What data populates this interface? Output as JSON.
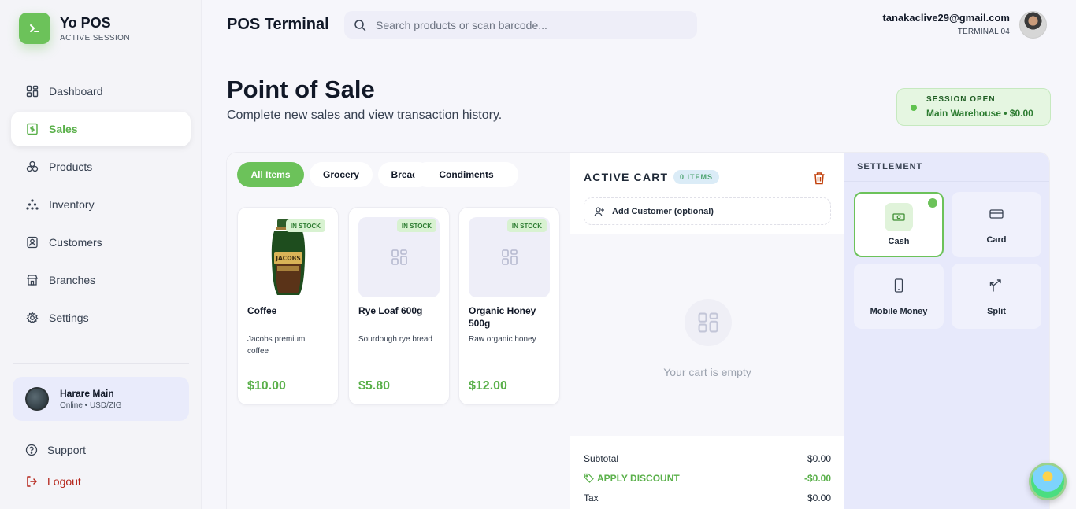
{
  "app": {
    "name": "Yo POS",
    "session_label": "ACTIVE SESSION",
    "brand_color": "#6cc25a"
  },
  "sidebar": {
    "items": [
      {
        "label": "Dashboard",
        "icon": "dashboard-icon"
      },
      {
        "label": "Sales",
        "icon": "sales-receipt-icon",
        "active": true
      },
      {
        "label": "Products",
        "icon": "products-icon"
      },
      {
        "label": "Inventory",
        "icon": "inventory-icon"
      },
      {
        "label": "Customers",
        "icon": "customers-icon"
      },
      {
        "label": "Branches",
        "icon": "branches-icon"
      },
      {
        "label": "Settings",
        "icon": "settings-icon"
      }
    ],
    "branch": {
      "name": "Harare Main",
      "status": "Online • USD/ZIG"
    },
    "support_label": "Support",
    "logout_label": "Logout"
  },
  "header": {
    "title": "POS Terminal",
    "search_placeholder": "Search products or scan barcode...",
    "user_email": "tanakaclive29@gmail.com",
    "terminal": "TERMINAL 04"
  },
  "page": {
    "title": "Point of Sale",
    "subtitle": "Complete new sales and view transaction history.",
    "session": {
      "title": "SESSION OPEN",
      "detail": "Main Warehouse • $0.00",
      "status_color": "#5fc24e"
    }
  },
  "categories": [
    "All Items",
    "Grocery",
    "Bread",
    "Condiments"
  ],
  "products": [
    {
      "name": "Coffee",
      "description": "Jacobs premium coffee",
      "price": "$10.00",
      "badge": "IN STOCK",
      "image": "jacobs-coffee-jar"
    },
    {
      "name": "Rye Loaf 600g",
      "description": "Sourdough rye bread",
      "price": "$5.80",
      "badge": "IN STOCK",
      "image": "placeholder-grid-icon"
    },
    {
      "name": "Organic Honey 500g",
      "description": "Raw organic honey",
      "price": "$12.00",
      "badge": "IN STOCK",
      "image": "placeholder-grid-icon"
    }
  ],
  "cart": {
    "title": "ACTIVE CART",
    "count": "0 ITEMS",
    "add_customer": "Add Customer (optional)",
    "empty_text": "Your cart is empty",
    "subtotal_label": "Subtotal",
    "subtotal_value": "$0.00",
    "discount_label": "APPLY DISCOUNT",
    "discount_value": "-$0.00",
    "tax_label": "Tax",
    "tax_value": "$0.00"
  },
  "settlement": {
    "title": "SETTLEMENT",
    "methods": [
      {
        "label": "Cash",
        "icon": "cash-icon",
        "selected": true
      },
      {
        "label": "Card",
        "icon": "card-icon"
      },
      {
        "label": "Mobile Money",
        "icon": "mobile-phone-icon"
      },
      {
        "label": "Split",
        "icon": "split-icon"
      }
    ]
  }
}
